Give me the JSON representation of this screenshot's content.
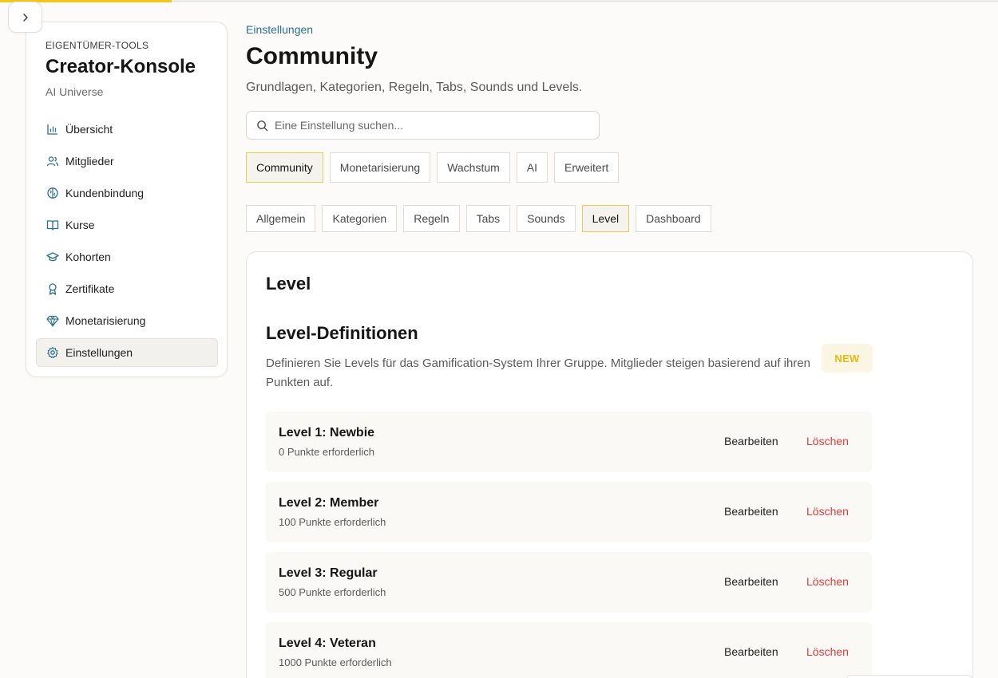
{
  "progress": {
    "fraction": 0.172,
    "color": "#f5c518"
  },
  "sidebar": {
    "eyebrow": "EIGENTÜMER-TOOLS",
    "title": "Creator-Konsole",
    "subtitle": "AI Universe",
    "items": [
      {
        "label": "Übersicht",
        "icon": "bar-chart-icon"
      },
      {
        "label": "Mitglieder",
        "icon": "users-icon"
      },
      {
        "label": "Kundenbindung",
        "icon": "brain-icon"
      },
      {
        "label": "Kurse",
        "icon": "book-icon"
      },
      {
        "label": "Kohorten",
        "icon": "graduation-cap-icon"
      },
      {
        "label": "Zertifikate",
        "icon": "award-icon"
      },
      {
        "label": "Monetarisierung",
        "icon": "gem-icon"
      },
      {
        "label": "Einstellungen",
        "icon": "gear-icon",
        "active": true
      }
    ]
  },
  "header": {
    "breadcrumb": "Einstellungen",
    "title": "Community",
    "description": "Grundlagen, Kategorien, Regeln, Tabs, Sounds und Levels."
  },
  "search": {
    "placeholder": "Eine Einstellung suchen...",
    "value": ""
  },
  "tabs": [
    {
      "label": "Community",
      "active": true
    },
    {
      "label": "Monetarisierung"
    },
    {
      "label": "Wachstum"
    },
    {
      "label": "AI"
    },
    {
      "label": "Erweitert"
    }
  ],
  "subtabs": [
    {
      "label": "Allgemein"
    },
    {
      "label": "Kategorien"
    },
    {
      "label": "Regeln"
    },
    {
      "label": "Tabs"
    },
    {
      "label": "Sounds"
    },
    {
      "label": "Level",
      "active": true
    },
    {
      "label": "Dashboard"
    }
  ],
  "card": {
    "title": "Level",
    "section_title": "Level-Definitionen",
    "section_desc": "Definieren Sie Levels für das Gamification-System Ihrer Gruppe. Mitglieder steigen basierend auf ihren Punkten auf.",
    "badge": "NEW",
    "edit_label": "Bearbeiten",
    "delete_label": "Löschen",
    "levels": [
      {
        "name": "Level 1: Newbie",
        "points": "0 Punkte erforderlich"
      },
      {
        "name": "Level 2: Member",
        "points": "100 Punkte erforderlich"
      },
      {
        "name": "Level 3: Regular",
        "points": "500 Punkte erforderlich"
      },
      {
        "name": "Level 4: Veteran",
        "points": "1000 Punkte erforderlich"
      }
    ]
  },
  "colors": {
    "accent_yellow": "#efcc4d",
    "link_blue": "#2c6f9a",
    "delete_red": "#e03a3a",
    "sidebar_icon": "#2b6f8f"
  }
}
